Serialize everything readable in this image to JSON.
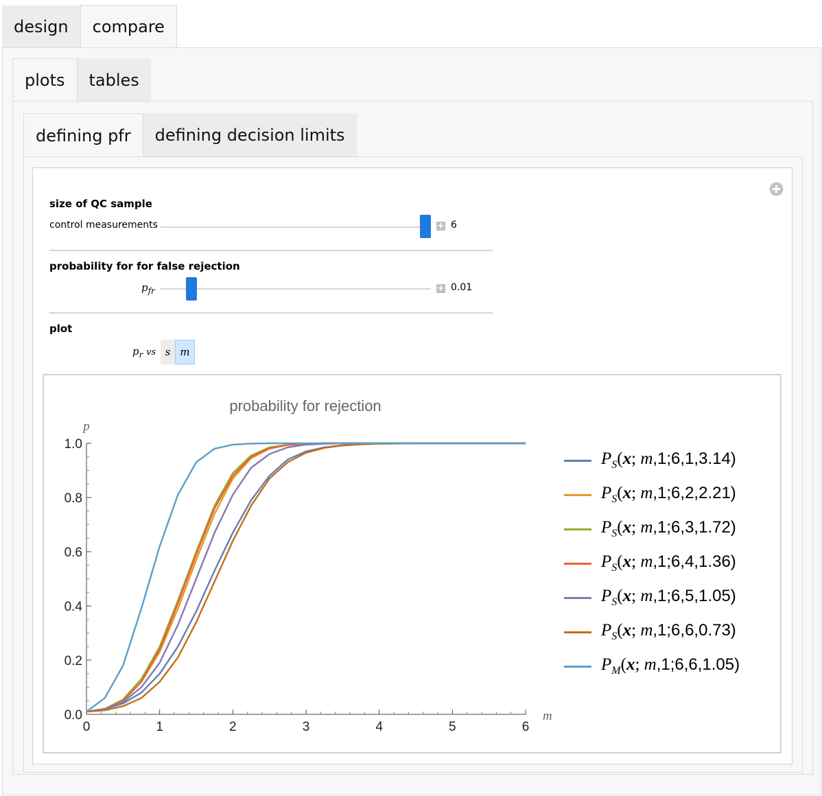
{
  "tabs_top": [
    {
      "label": "design"
    },
    {
      "label": "compare"
    }
  ],
  "tabs_mid": [
    {
      "label": "plots"
    },
    {
      "label": "tables"
    }
  ],
  "tabs_inner": [
    {
      "label": "defining pfr"
    },
    {
      "label": "defining decision limits"
    }
  ],
  "controls": {
    "qc_sample": {
      "title": "size of QC sample",
      "label": "control measurements",
      "value": "6",
      "position": 1.0
    },
    "pfr": {
      "title": "probability for for false rejection",
      "label": "p",
      "label_sub": "fr",
      "value": "0.01",
      "position": 0.08
    },
    "plot": {
      "title": "plot",
      "label_p": "p",
      "label_sub": "r",
      "label_vs": "vs",
      "options": [
        {
          "label": "s",
          "selected": false
        },
        {
          "label": "m",
          "selected": true
        }
      ]
    }
  },
  "colors": {
    "accent": "#1f7ae0",
    "selected_option": "#cde8ff"
  },
  "chart_data": {
    "type": "line",
    "title": "probability for rejection",
    "xlabel": "m",
    "ylabel": "p",
    "xlim": [
      0,
      6
    ],
    "ylim": [
      0,
      1
    ],
    "x_ticks": [
      "0",
      "1",
      "2",
      "3",
      "4",
      "5",
      "6"
    ],
    "y_ticks": [
      "0.0",
      "0.2",
      "0.4",
      "0.6",
      "0.8",
      "1.0"
    ],
    "grid": false,
    "legend_position": "right",
    "x": [
      0,
      0.25,
      0.5,
      0.75,
      1,
      1.25,
      1.5,
      1.75,
      2,
      2.25,
      2.5,
      2.75,
      3,
      3.25,
      3.5,
      3.75,
      4,
      4.5,
      5,
      5.5,
      6
    ],
    "series": [
      {
        "name": "P_S(x; m,1;6,1,3.14)",
        "color": "#5e81b5",
        "values": [
          0.01,
          0.02,
          0.04,
          0.08,
          0.15,
          0.25,
          0.38,
          0.53,
          0.67,
          0.79,
          0.88,
          0.94,
          0.97,
          0.985,
          0.993,
          0.997,
          0.999,
          1,
          1,
          1,
          1
        ]
      },
      {
        "name": "P_S(x; m,1;6,2,2.21)",
        "color": "#e19c24",
        "values": [
          0.01,
          0.02,
          0.05,
          0.12,
          0.23,
          0.39,
          0.57,
          0.74,
          0.87,
          0.945,
          0.98,
          0.994,
          0.998,
          1,
          1,
          1,
          1,
          1,
          1,
          1,
          1
        ]
      },
      {
        "name": "P_S(x; m,1;6,3,1.72)",
        "color": "#8fb032",
        "values": [
          0.01,
          0.02,
          0.055,
          0.13,
          0.25,
          0.42,
          0.6,
          0.77,
          0.89,
          0.955,
          0.985,
          0.995,
          0.999,
          1,
          1,
          1,
          1,
          1,
          1,
          1,
          1
        ]
      },
      {
        "name": "P_S(x; m,1;6,4,1.36)",
        "color": "#eb6235",
        "values": [
          0.01,
          0.02,
          0.05,
          0.12,
          0.24,
          0.41,
          0.59,
          0.76,
          0.88,
          0.95,
          0.982,
          0.994,
          0.998,
          1,
          1,
          1,
          1,
          1,
          1,
          1,
          1
        ]
      },
      {
        "name": "P_S(x; m,1;6,5,1.05)",
        "color": "#8778b3",
        "values": [
          0.01,
          0.02,
          0.045,
          0.1,
          0.19,
          0.33,
          0.5,
          0.67,
          0.81,
          0.91,
          0.96,
          0.985,
          0.995,
          0.998,
          1,
          1,
          1,
          1,
          1,
          1,
          1
        ]
      },
      {
        "name": "P_S(x; m,1;6,6,0.73)",
        "color": "#c56e1a",
        "values": [
          0.01,
          0.015,
          0.03,
          0.06,
          0.12,
          0.21,
          0.34,
          0.49,
          0.64,
          0.77,
          0.87,
          0.93,
          0.965,
          0.983,
          0.992,
          0.996,
          0.998,
          1,
          1,
          1,
          1
        ]
      },
      {
        "name": "P_M(x; m,1;6,6,1.05)",
        "color": "#5d9ec7",
        "values": [
          0.01,
          0.06,
          0.18,
          0.39,
          0.62,
          0.81,
          0.93,
          0.98,
          0.995,
          0.999,
          1,
          1,
          1,
          1,
          1,
          1,
          1,
          1,
          1,
          1,
          1
        ]
      }
    ],
    "legend_labels": [
      {
        "sym": "P",
        "sub": "S",
        "args": ";6,1,3.14)"
      },
      {
        "sym": "P",
        "sub": "S",
        "args": ";6,2,2.21)"
      },
      {
        "sym": "P",
        "sub": "S",
        "args": ";6,3,1.72)"
      },
      {
        "sym": "P",
        "sub": "S",
        "args": ";6,4,1.36)"
      },
      {
        "sym": "P",
        "sub": "S",
        "args": ";6,5,1.05)"
      },
      {
        "sym": "P",
        "sub": "S",
        "args": ";6,6,0.73)"
      },
      {
        "sym": "P",
        "sub": "M",
        "args": ";6,6,1.05)"
      }
    ]
  }
}
